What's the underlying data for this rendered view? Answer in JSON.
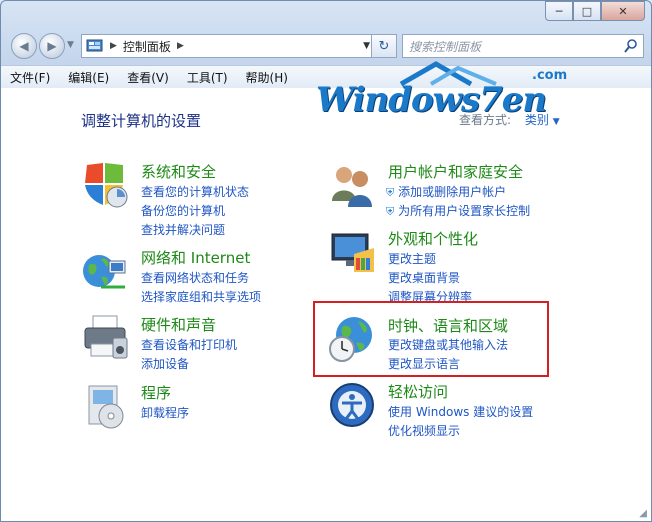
{
  "window": {
    "controls": {
      "minimize": "─",
      "maximize": "□",
      "close": "✕"
    }
  },
  "address_bar": {
    "path": [
      "控制面板"
    ],
    "search_placeholder": "搜索控制面板"
  },
  "menu": [
    "文件(F)",
    "编辑(E)",
    "查看(V)",
    "工具(T)",
    "帮助(H)"
  ],
  "content": {
    "title": "调整计算机的设置",
    "view_by_label": "查看方式:",
    "view_by_value": "类别",
    "watermark": "Windows7en",
    "watermark_suffix": ".com",
    "categories": [
      {
        "id": "system",
        "title": "系统和安全",
        "links": [
          "查看您的计算机状态",
          "备份您的计算机",
          "查找并解决问题"
        ],
        "icon": "shield-icon"
      },
      {
        "id": "network",
        "title": "网络和 Internet",
        "links": [
          "查看网络状态和任务",
          "选择家庭组和共享选项"
        ],
        "icon": "network-globe-icon"
      },
      {
        "id": "hardware",
        "title": "硬件和声音",
        "links": [
          "查看设备和打印机",
          "添加设备"
        ],
        "icon": "printer-icon"
      },
      {
        "id": "programs",
        "title": "程序",
        "links": [
          "卸载程序"
        ],
        "icon": "programs-icon"
      },
      {
        "id": "users",
        "title": "用户帐户和家庭安全",
        "links": [
          "添加或删除用户帐户",
          "为所有用户设置家长控制"
        ],
        "icon": "users-icon"
      },
      {
        "id": "appearance",
        "title": "外观和个性化",
        "links": [
          "更改主题",
          "更改桌面背景",
          "调整屏幕分辨率"
        ],
        "icon": "monitor-icon"
      },
      {
        "id": "clock",
        "title": "时钟、语言和区域",
        "links": [
          "更改键盘或其他输入法",
          "更改显示语言"
        ],
        "icon": "clock-globe-icon"
      },
      {
        "id": "ease",
        "title": "轻松访问",
        "links": [
          "使用 Windows 建议的设置",
          "优化视频显示"
        ],
        "icon": "ease-of-access-icon"
      }
    ]
  },
  "highlight_color": "#d42020"
}
